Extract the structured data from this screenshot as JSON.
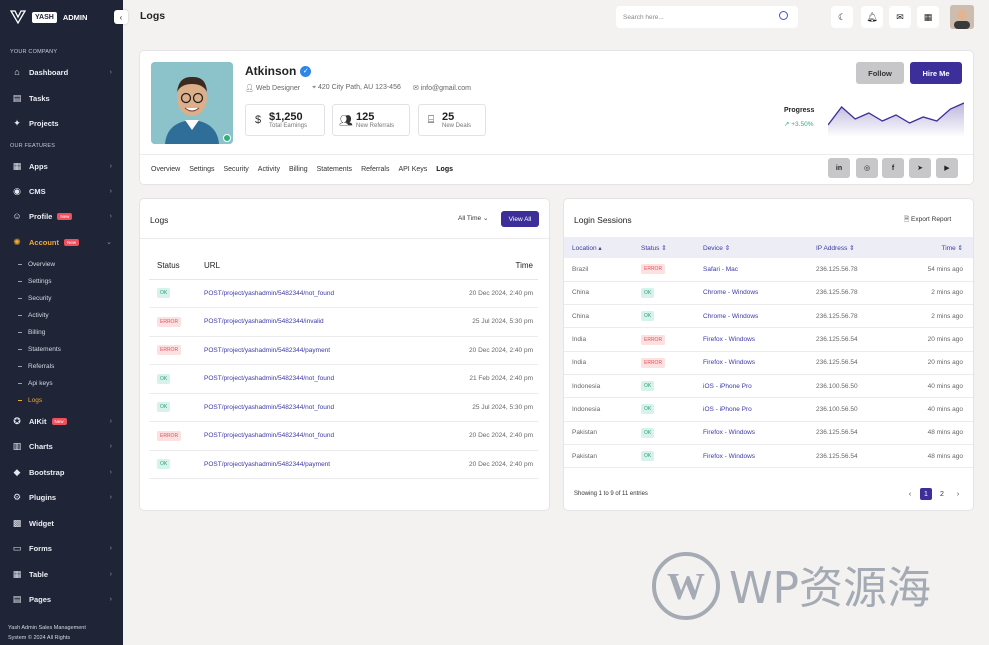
{
  "brand": {
    "name": "YASH",
    "suffix": "ADMIN"
  },
  "sidebar": {
    "section1": "YOUR COMPANY",
    "section2": "OUR FEATURES",
    "items": [
      {
        "label": "Dashboard",
        "icon": "home-icon"
      },
      {
        "label": "Tasks",
        "icon": "tasks-icon"
      },
      {
        "label": "Projects",
        "icon": "projects-icon"
      },
      {
        "label": "Apps",
        "icon": "apps-icon"
      },
      {
        "label": "CMS",
        "icon": "cms-icon"
      },
      {
        "label": "Profile",
        "icon": "profile-icon",
        "badge": "New"
      },
      {
        "label": "Account",
        "icon": "account-icon",
        "badge": "New"
      },
      {
        "label": "AIKit",
        "icon": "aikit-icon",
        "badge": "New"
      },
      {
        "label": "Charts",
        "icon": "charts-icon"
      },
      {
        "label": "Bootstrap",
        "icon": "bootstrap-icon"
      },
      {
        "label": "Plugins",
        "icon": "plugins-icon"
      },
      {
        "label": "Widget",
        "icon": "widget-icon"
      },
      {
        "label": "Forms",
        "icon": "forms-icon"
      },
      {
        "label": "Table",
        "icon": "table-icon"
      },
      {
        "label": "Pages",
        "icon": "pages-icon"
      }
    ],
    "account_sub": [
      "Overview",
      "Settings",
      "Security",
      "Activity",
      "Billing",
      "Statements",
      "Referrals",
      "Api keys",
      "Logs"
    ],
    "footer1": "Yash Admin Sales Management",
    "footer2": "System © 2024 All Rights"
  },
  "header": {
    "title": "Logs",
    "search_placeholder": "Search here..."
  },
  "profile": {
    "name": "Atkinson",
    "role": "Web Designer",
    "address": "420 City Path, AU 123-456",
    "email": "info@gmail.com",
    "stats": [
      {
        "value": "$1,250",
        "label": "Total Earnings"
      },
      {
        "value": "125",
        "label": "New Referrals"
      },
      {
        "value": "25",
        "label": "New Deals"
      }
    ],
    "follow": "Follow",
    "hire": "Hire Me",
    "progress_label": "Progress",
    "progress_value": "+3.50%",
    "progress_series": [
      30,
      75,
      45,
      60,
      40,
      55,
      35,
      50,
      40,
      70,
      85
    ],
    "tabs": [
      "Overview",
      "Settings",
      "Security",
      "Activity",
      "Billing",
      "Statements",
      "Referrals",
      "API Keys",
      "Logs"
    ],
    "social": [
      "in",
      "ig",
      "f",
      "tg",
      "yt"
    ]
  },
  "logs": {
    "title": "Logs",
    "filter": "All Time",
    "view_all": "View All",
    "headers": [
      "Status",
      "URL",
      "Time"
    ],
    "rows": [
      {
        "status": "OK",
        "url": "POST/project/yashadmin/5482344/not_found",
        "time": "20 Dec 2024, 2:40 pm"
      },
      {
        "status": "ERROR",
        "url": "POST/project/yashadmin/5482344/invalid",
        "time": "25 Jul 2024, 5:30 pm"
      },
      {
        "status": "ERROR",
        "url": "POST/project/yashadmin/5482344/payment",
        "time": "20 Dec 2024, 2:40 pm"
      },
      {
        "status": "OK",
        "url": "POST/project/yashadmin/5482344/not_found",
        "time": "21 Feb 2024, 2:40 pm"
      },
      {
        "status": "OK",
        "url": "POST/project/yashadmin/5482344/not_found",
        "time": "25 Jul 2024, 5:30 pm"
      },
      {
        "status": "ERROR",
        "url": "POST/project/yashadmin/5482344/not_found",
        "time": "20 Dec 2024, 2:40 pm"
      },
      {
        "status": "OK",
        "url": "POST/project/yashadmin/5482344/payment",
        "time": "20 Dec 2024, 2:40 pm"
      }
    ]
  },
  "sessions": {
    "title": "Login Sessions",
    "export": "Export Report",
    "headers": [
      "Location",
      "Status",
      "Device",
      "IP Address",
      "Time"
    ],
    "rows": [
      {
        "location": "Brazil",
        "status": "ERROR",
        "device": "Safari - Mac",
        "ip": "236.125.56.78",
        "time": "54 mins ago"
      },
      {
        "location": "China",
        "status": "OK",
        "device": "Chrome - Windows",
        "ip": "236.125.56.78",
        "time": "2 mins ago"
      },
      {
        "location": "China",
        "status": "OK",
        "device": "Chrome - Windows",
        "ip": "236.125.56.78",
        "time": "2 mins ago"
      },
      {
        "location": "India",
        "status": "ERROR",
        "device": "Firefox - Windows",
        "ip": "236.125.56.54",
        "time": "20 mins ago"
      },
      {
        "location": "India",
        "status": "ERROR",
        "device": "Firefox - Windows",
        "ip": "236.125.56.54",
        "time": "20 mins ago"
      },
      {
        "location": "Indonesia",
        "status": "OK",
        "device": "iOS - iPhone Pro",
        "ip": "236.100.56.50",
        "time": "40 mins ago"
      },
      {
        "location": "Indonesia",
        "status": "OK",
        "device": "iOS - iPhone Pro",
        "ip": "236.100.56.50",
        "time": "40 mins ago"
      },
      {
        "location": "Pakistan",
        "status": "OK",
        "device": "Firefox - Windows",
        "ip": "236.125.56.54",
        "time": "48 mins ago"
      },
      {
        "location": "Pakistan",
        "status": "OK",
        "device": "Firefox - Windows",
        "ip": "236.125.56.54",
        "time": "48 mins ago"
      }
    ],
    "showing": "Showing 1 to 9 of 11 entries",
    "pages": [
      "1",
      "2"
    ]
  },
  "watermark": "WP资源海",
  "colors": {
    "accent": "#3d2f9a",
    "sidebar": "#1f2437",
    "active": "#f0a836",
    "ok": "#2e9c78",
    "error": "#e0565e"
  }
}
